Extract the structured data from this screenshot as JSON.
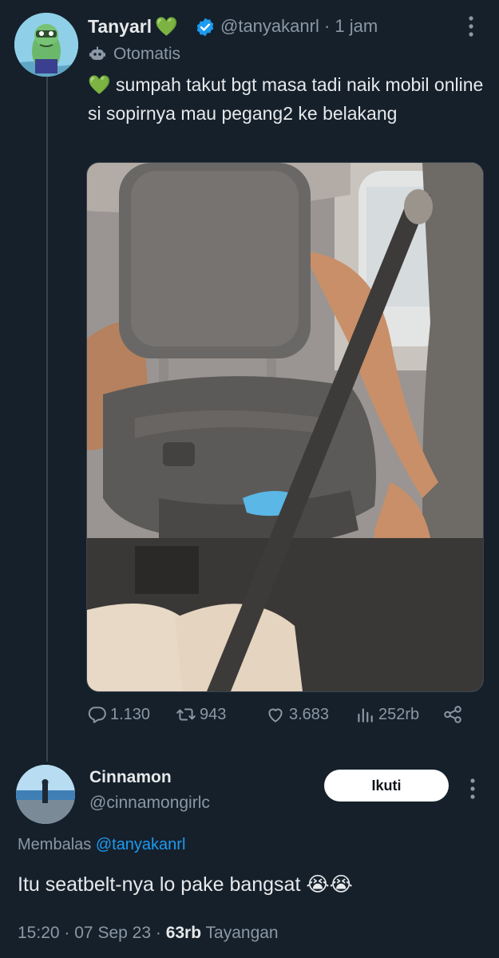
{
  "tweet": {
    "author_name": "Tanyarl",
    "author_name_emoji": "💚",
    "handle": "@tanyakanrl",
    "time_sep": "·",
    "time": "1 jam",
    "automated_label": "Otomatis",
    "text_emoji": "💚",
    "text": "sumpah takut bgt masa tadi naik mobil online si sopirnya mau pegang2 ke belakang",
    "media_icon": "photo-car-backseat",
    "stats": {
      "replies": "1.130",
      "retweets": "943",
      "likes": "3.683",
      "views": "252rb"
    }
  },
  "reply": {
    "author_name": "Cinnamon",
    "handle": "@cinnamongirlc",
    "follow_label": "Ikuti",
    "replying_prefix": "Membalas",
    "replying_mention": "@tanyakanrl",
    "text": "Itu seatbelt-nya lo pake bangsat",
    "text_emoji": "😭😭",
    "time": "15:20",
    "sep1": "·",
    "date": "07 Sep 23",
    "sep2": "·",
    "views_count": "63rb",
    "views_label": "Tayangan"
  },
  "icons": {
    "verified": "verified-badge-icon",
    "automated": "bot-icon",
    "reply": "reply-icon",
    "retweet": "retweet-icon",
    "like": "heart-icon",
    "views": "views-chart-icon",
    "share": "share-icon",
    "more": "more-vertical-icon"
  },
  "colors": {
    "background": "#15202b",
    "text": "#e7e9ea",
    "secondary": "#8b98a5",
    "accent": "#1d9bf0"
  }
}
